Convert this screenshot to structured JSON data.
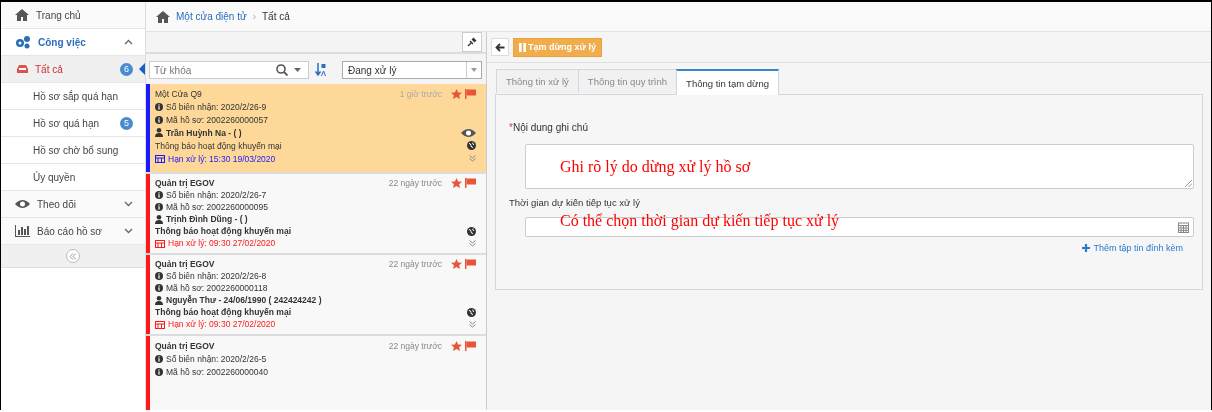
{
  "sidebar": {
    "items": [
      {
        "label": "Trang chủ",
        "selected": false
      },
      {
        "label": "Công việc",
        "selected": false,
        "expanded": true,
        "children": [
          {
            "label": "Tất cả",
            "badge": "6",
            "selected": true
          },
          {
            "label": "Hồ sơ sắp quá hạn",
            "selected": false
          },
          {
            "label": "Hồ sơ quá hạn",
            "badge": "5",
            "selected": false
          },
          {
            "label": "Hồ sơ chờ bổ sung",
            "selected": false
          },
          {
            "label": "Ủy quyền",
            "selected": false
          }
        ]
      },
      {
        "label": "Theo dõi",
        "selected": false,
        "expanded": false
      },
      {
        "label": "Báo cáo hồ sơ",
        "selected": false,
        "expanded": false
      }
    ]
  },
  "breadcrumb": {
    "separator": "›",
    "items": [
      "Một cửa điện tử",
      "Tất cả"
    ]
  },
  "list": {
    "search": {
      "placeholder": "Từ khóa"
    },
    "status_filter": "Đang xử lý",
    "cards": [
      {
        "sender": "Một Cửa Q9",
        "time": "1 giờ trước",
        "receipt": "Số biên nhận: 2020/2/26-9",
        "code": "Mã hồ sơ: 2002260000057",
        "person": "Trần Huỳnh Na - ( )",
        "subject": "Thông báo hoạt động khuyến mại",
        "deadline": "Hạn xử lý: 15:30 19/03/2020",
        "color": "#1a1aff",
        "selected": true,
        "watched": true
      },
      {
        "sender": "Quản trị EGOV",
        "time": "22 ngày trước",
        "receipt": "Số biên nhận: 2020/2/26-7",
        "code": "Mã hồ sơ: 2002260000095",
        "person": "Trịnh Đình Dũng - ( )",
        "subject": "Thông báo hoạt động khuyến mại",
        "deadline": "Hạn xử lý: 09:30 27/02/2020",
        "color": "#ff1a1a",
        "selected": false,
        "watched": false
      },
      {
        "sender": "Quản trị EGOV",
        "time": "22 ngày trước",
        "receipt": "Số biên nhận: 2020/2/26-8",
        "code": "Mã hồ sơ: 2002260000118",
        "person": "Nguyễn Thư - 24/06/1990 ( 242424242 )",
        "subject": "Thông báo hoạt động khuyến mại",
        "deadline": "Hạn xử lý: 09:30 27/02/2020",
        "color": "#ff1a1a",
        "selected": false,
        "watched": false
      },
      {
        "sender": "Quản trị EGOV",
        "time": "22 ngày trước",
        "receipt": "Số biên nhận: 2020/2/26-5",
        "code": "Mã hồ sơ: 2002260000040",
        "color": "#ff1a1a",
        "selected": false
      }
    ]
  },
  "detail": {
    "pause_button": "Tạm dừng xử lý",
    "tabs": [
      {
        "label": "Thông tin xử lý",
        "selected": false
      },
      {
        "label": "Thông tin quy trình",
        "selected": false
      },
      {
        "label": "Thông tin tạm dừng",
        "selected": true
      }
    ],
    "note_label": "Nội dung ghi chú",
    "required_mark": "*",
    "note_annotation": "Ghi rõ lý do dừng xử lý hồ sơ",
    "resume_label": "Thời gian dự kiến tiếp tục xử lý",
    "resume_annotation": "Có thể chọn thời gian dự kiến tiếp tục xử lý",
    "attach_link": "Thêm tập tin đính kèm"
  }
}
